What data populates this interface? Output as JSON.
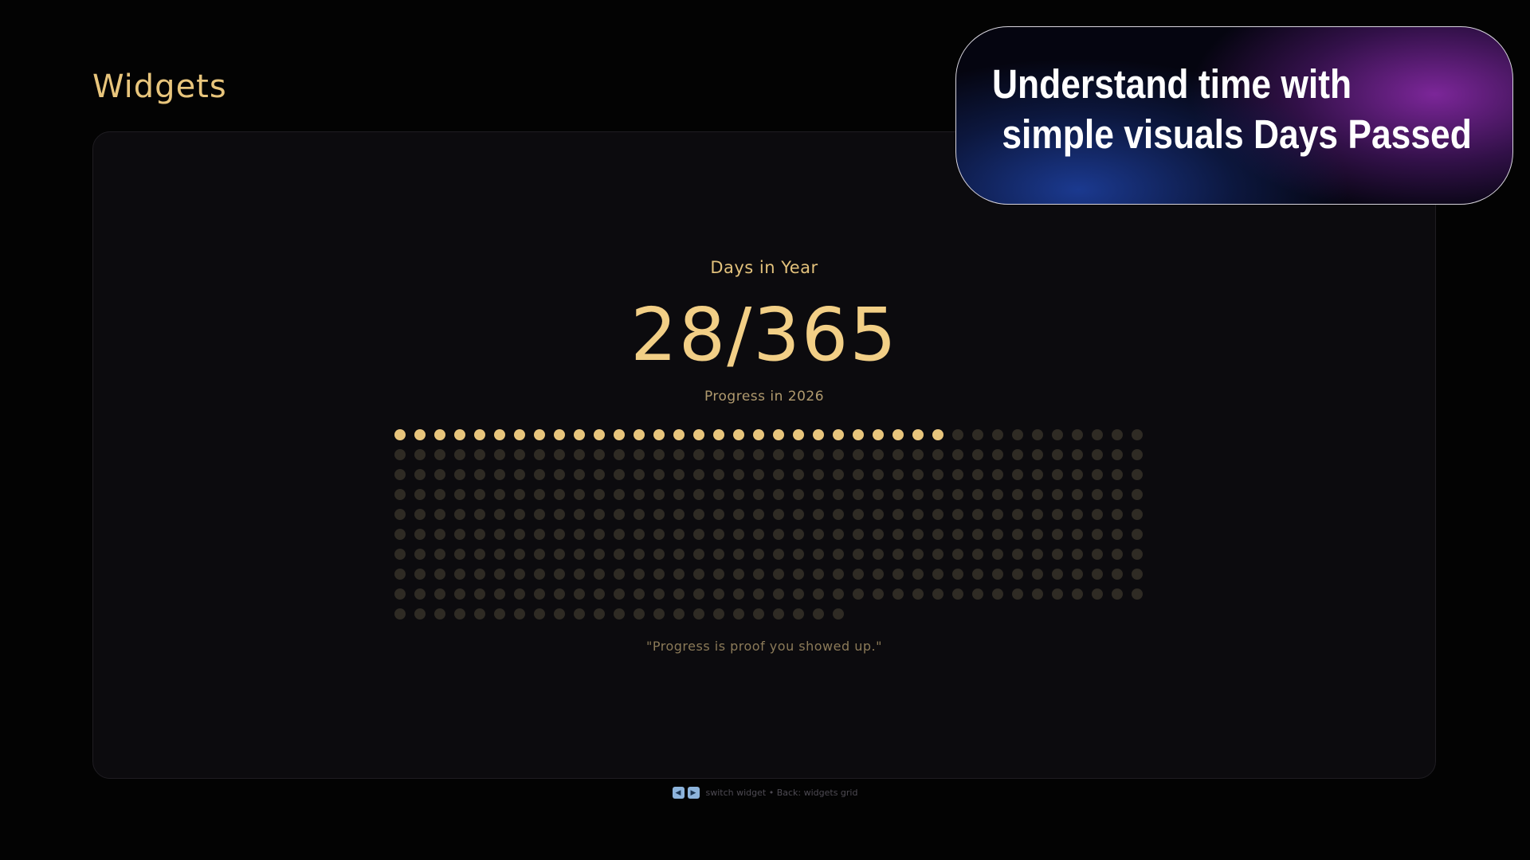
{
  "page": {
    "title": "Widgets"
  },
  "widget": {
    "label": "Days in Year",
    "value": "28/365",
    "subtitle": "Progress in 2026",
    "days_passed": 28,
    "days_total": 365,
    "quote": "\"Progress is proof you showed up.\""
  },
  "footer": {
    "prev_key": "◀",
    "next_key": "▶",
    "hint": "switch widget • Back: widgets grid"
  },
  "promo": {
    "line1": "Understand time with",
    "line2": " simple visuals Days Passed"
  },
  "colors": {
    "accent": "#e8c57c",
    "dot_empty": "#2f2b24",
    "background": "#030303",
    "card": "#0c0b0e"
  }
}
